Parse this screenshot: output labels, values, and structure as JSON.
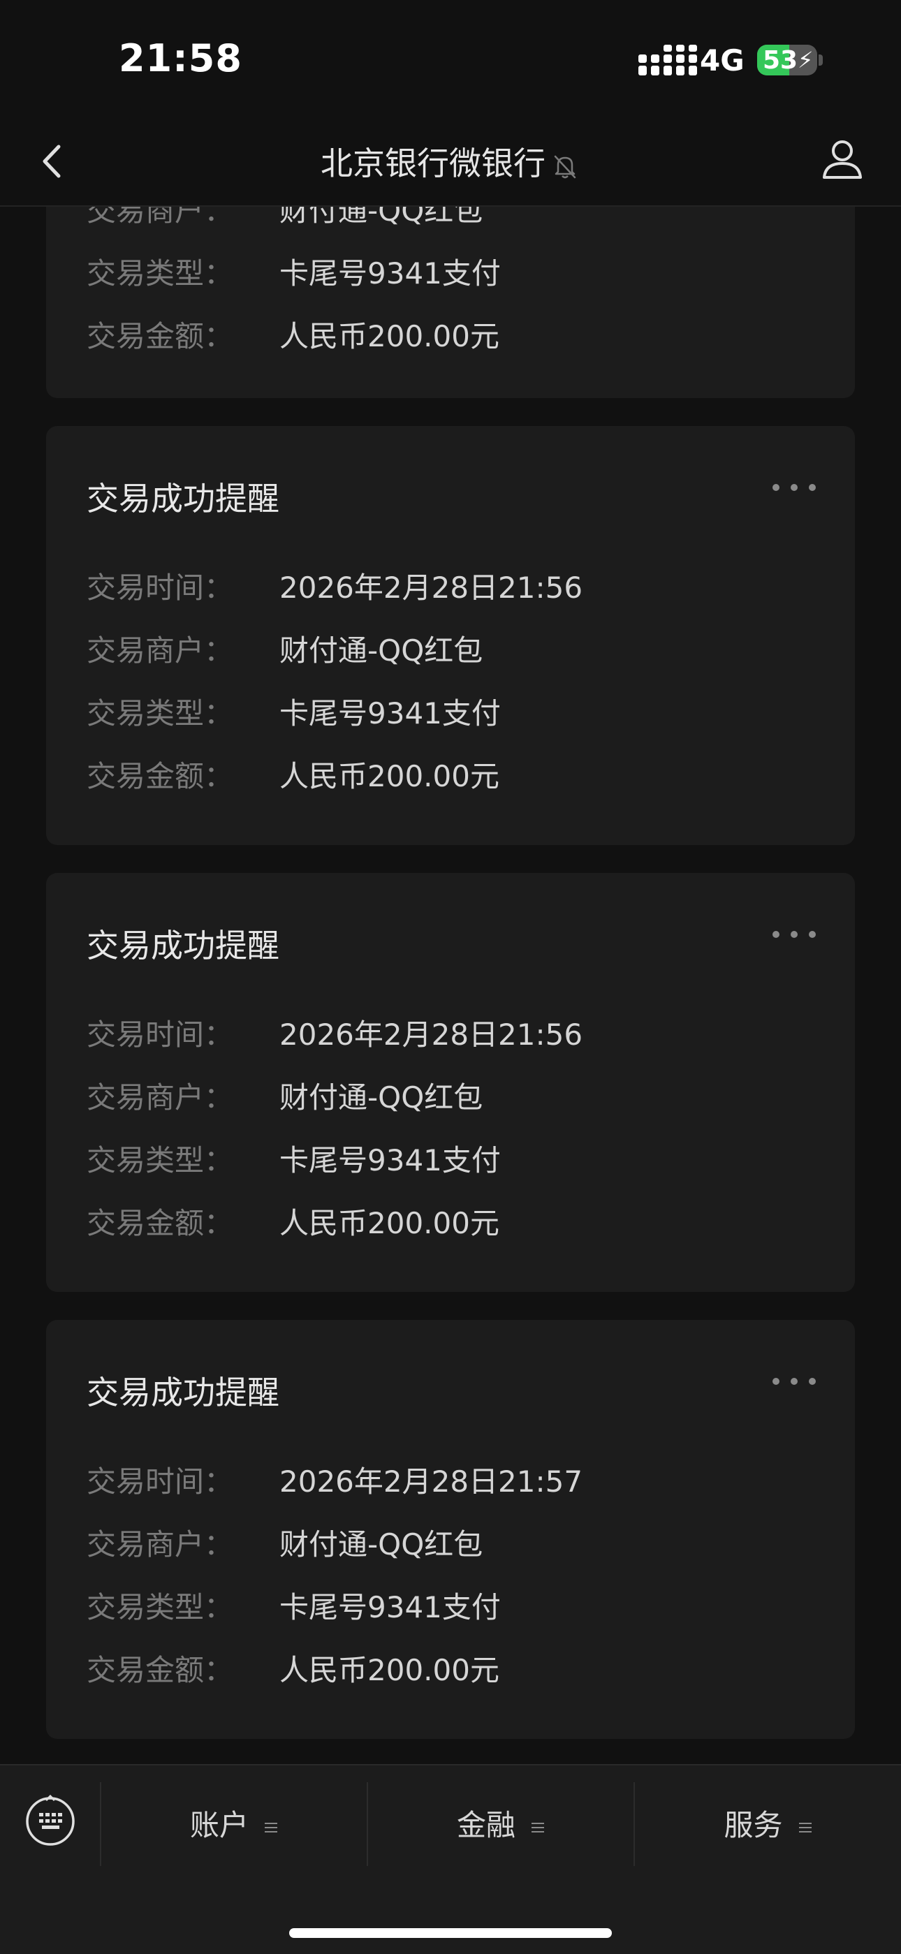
{
  "status_bar": {
    "time": "21:58",
    "network": "4G",
    "battery": "53",
    "battery_level": 0.53
  },
  "nav": {
    "title": "北京银行微银行"
  },
  "cards": [
    {
      "partial": true,
      "title": "",
      "rows": [
        {
          "label": "交易商户：",
          "value": "财付通-QQ红包"
        },
        {
          "label": "交易类型：",
          "value": "卡尾号9341支付"
        },
        {
          "label": "交易金额：",
          "value": "人民币200.00元"
        }
      ]
    },
    {
      "title": "交易成功提醒",
      "rows": [
        {
          "label": "交易时间：",
          "value": "2026年2月28日21:56"
        },
        {
          "label": "交易商户：",
          "value": "财付通-QQ红包"
        },
        {
          "label": "交易类型：",
          "value": "卡尾号9341支付"
        },
        {
          "label": "交易金额：",
          "value": "人民币200.00元"
        }
      ]
    },
    {
      "title": "交易成功提醒",
      "rows": [
        {
          "label": "交易时间：",
          "value": "2026年2月28日21:56"
        },
        {
          "label": "交易商户：",
          "value": "财付通-QQ红包"
        },
        {
          "label": "交易类型：",
          "value": "卡尾号9341支付"
        },
        {
          "label": "交易金额：",
          "value": "人民币200.00元"
        }
      ]
    },
    {
      "title": "交易成功提醒",
      "rows": [
        {
          "label": "交易时间：",
          "value": "2026年2月28日21:57"
        },
        {
          "label": "交易商户：",
          "value": "财付通-QQ红包"
        },
        {
          "label": "交易类型：",
          "value": "卡尾号9341支付"
        },
        {
          "label": "交易金额：",
          "value": "人民币200.00元"
        }
      ]
    }
  ],
  "tabs": [
    {
      "label": "账户"
    },
    {
      "label": "金融"
    },
    {
      "label": "服务"
    }
  ],
  "icons": {
    "back": "chevron-left-icon",
    "mute": "bell-slash-icon",
    "profile": "person-icon",
    "more": "ellipsis-icon",
    "keyboard": "keyboard-icon",
    "tab_menu": "menu-lines-icon"
  },
  "colors": {
    "background": "#111111",
    "card": "#1c1c1c",
    "label": "#7a7a7a",
    "value": "#d6d6d6",
    "battery": "#34c759"
  }
}
